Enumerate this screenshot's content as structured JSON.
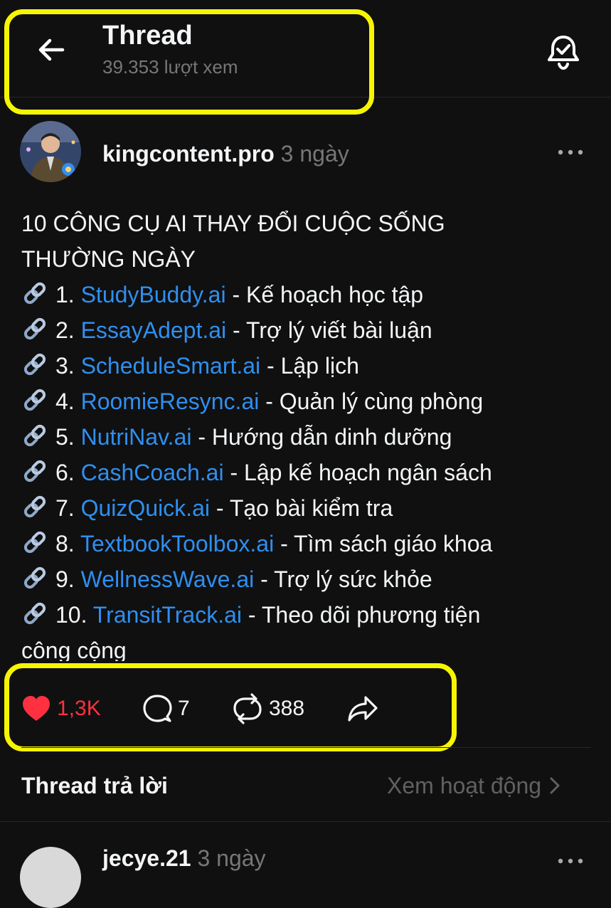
{
  "header": {
    "title": "Thread",
    "views": "39.353 lượt xem",
    "back_icon": "arrow-left-icon",
    "bell_icon": "bell-check-icon"
  },
  "post": {
    "author": "kingcontent.pro",
    "time": "3 ngày",
    "heading_line1": "10 CÔNG CỤ AI THAY ĐỔI CUỘC SỐNG",
    "heading_line2": "THƯỜNG NGÀY",
    "items": [
      {
        "num": "1.",
        "link": "StudyBuddy.ai",
        "desc": " - Kế hoạch học tập"
      },
      {
        "num": "2.",
        "link": "EssayAdept.ai",
        "desc": " - Trợ lý viết bài luận"
      },
      {
        "num": "3.",
        "link": "ScheduleSmart.ai",
        "desc": " - Lập lịch"
      },
      {
        "num": "4.",
        "link": "RoomieResync.ai",
        "desc": " - Quản lý cùng phòng"
      },
      {
        "num": "5.",
        "link": "NutriNav.ai",
        "desc": " - Hướng dẫn dinh dưỡng"
      },
      {
        "num": "6.",
        "link": "CashCoach.ai",
        "desc": " - Lập kế hoạch ngân sách"
      },
      {
        "num": "7.",
        "link": "QuizQuick.ai",
        "desc": " - Tạo bài kiểm tra"
      },
      {
        "num": "8.",
        "link": "TextbookToolbox.ai",
        "desc": " - Tìm sách giáo khoa"
      },
      {
        "num": "9.",
        "link": "WellnessWave.ai",
        "desc": " - Trợ lý sức khỏe"
      },
      {
        "num": "10.",
        "link": "TransitTrack.ai",
        "desc": " - Theo dõi phương tiện"
      }
    ],
    "last_line": "công cộng"
  },
  "actions": {
    "likes": "1,3K",
    "comments": "7",
    "reposts": "388",
    "like_color": "#ff3040"
  },
  "replies": {
    "title": "Thread trả lời",
    "activity": "Xem hoạt động"
  },
  "reply": {
    "author": "jecye.21",
    "time": "3 ngày"
  },
  "colors": {
    "background": "#101010",
    "link": "#2f8ff0",
    "highlight": "#f6f600"
  }
}
